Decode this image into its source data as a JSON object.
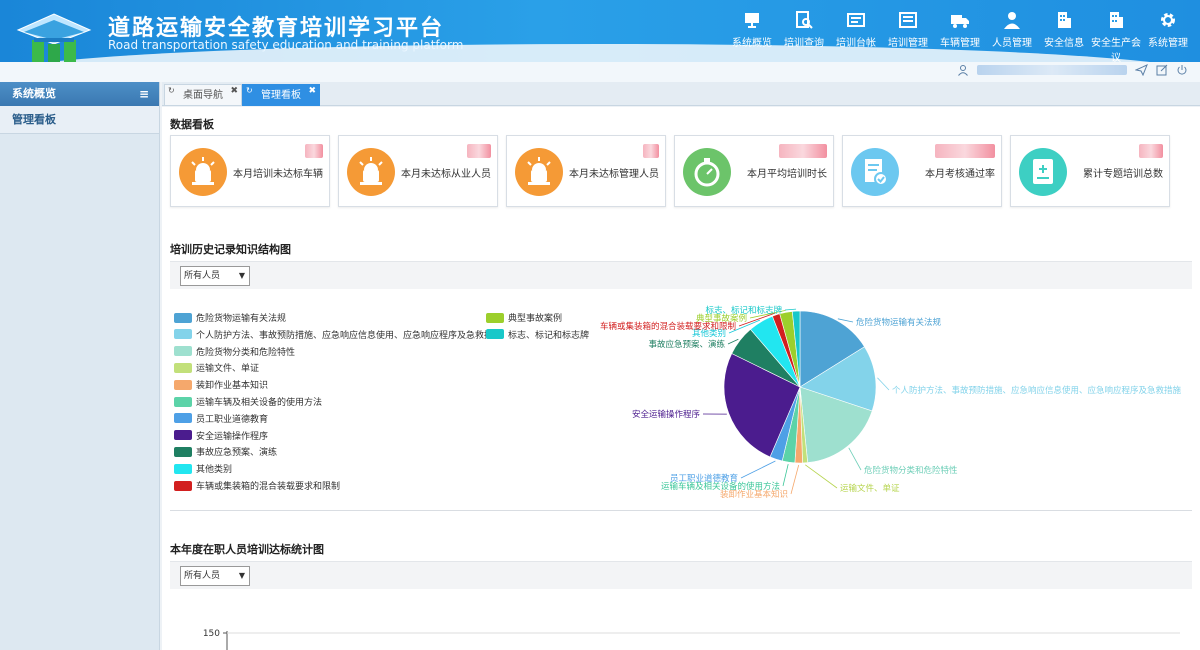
{
  "header": {
    "title_cn": "道路运输安全教育培训学习平台",
    "title_en": "Road transportation safety education and training platform",
    "nav": [
      {
        "label": "系统概览",
        "icon": "monitor-icon"
      },
      {
        "label": "培训查询",
        "icon": "search-doc-icon"
      },
      {
        "label": "培训台帐",
        "icon": "ledger-icon"
      },
      {
        "label": "培训管理",
        "icon": "training-icon"
      },
      {
        "label": "车辆管理",
        "icon": "truck-icon"
      },
      {
        "label": "人员管理",
        "icon": "user-icon"
      },
      {
        "label": "安全信息",
        "icon": "building-icon"
      },
      {
        "label": "安全生产会议",
        "icon": "meeting-icon"
      },
      {
        "label": "系统管理",
        "icon": "gear-icon"
      }
    ]
  },
  "sidebar": {
    "title": "系统概览",
    "items": [
      {
        "label": "管理看板"
      }
    ]
  },
  "tabs": [
    {
      "label": "桌面导航",
      "active": false
    },
    {
      "label": "管理看板",
      "active": true
    }
  ],
  "dashboard": {
    "title": "数据看板",
    "cards": [
      {
        "label": "本月培训未达标车辆",
        "color": "#f59a36",
        "icon": "alarm-icon"
      },
      {
        "label": "本月未达标从业人员",
        "color": "#f59a36",
        "icon": "alarm-icon"
      },
      {
        "label": "本月未达标管理人员",
        "color": "#f59a36",
        "icon": "alarm-icon"
      },
      {
        "label": "本月平均培训时长",
        "color": "#6cc46a",
        "icon": "stopwatch-icon"
      },
      {
        "label": "本月考核通过率",
        "color": "#6cc8f0",
        "icon": "document-check-icon"
      },
      {
        "label": "累计专题培训总数",
        "color": "#3dcfc3",
        "icon": "book-icon"
      }
    ]
  },
  "knowledge_chart": {
    "title": "培训历史记录知识结构图",
    "filter": "所有人员"
  },
  "chart_data": {
    "type": "pie",
    "categories": [
      "危险货物运输有关法规",
      "个人防护方法、事故预防措施、应急响应信息使用、应急响应程序及急救措施",
      "危险货物分类和危险特性",
      "运输文件、单证",
      "装卸作业基本知识",
      "运输车辆及相关设备的使用方法",
      "员工职业道德教育",
      "安全运输操作程序",
      "事故应急预案、演练",
      "其他类别",
      "车辆或集装箱的混合装载要求和限制",
      "典型事故案例",
      "标志、标记和标志牌"
    ],
    "values": [
      15,
      13,
      17,
      1,
      1.5,
      2.5,
      2.5,
      24,
      6,
      5,
      1.5,
      2.5,
      1.5
    ],
    "colors": [
      "#4ea3d4",
      "#83d3ea",
      "#9ee0cf",
      "#c2e07a",
      "#f5a86c",
      "#5cd3a8",
      "#4ea0e6",
      "#4b1c8e",
      "#1f7f62",
      "#22e6f0",
      "#d21f1f",
      "#9ccf2c",
      "#18c8c9"
    ],
    "label_colors": [
      "#4ea3d4",
      "#83d3ea",
      "#6fcfb8",
      "#b6d44e",
      "#f5a86c",
      "#3dc79a",
      "#4ea0e6",
      "#4b1c8e",
      "#1f7f62",
      "#18c8d8",
      "#d21f1f",
      "#9ccf2c",
      "#18c8c9"
    ],
    "legend_placement": "left"
  },
  "annual_chart": {
    "title": "本年度在职人员培训达标统计图",
    "filter": "所有人员",
    "y_tick": "150"
  }
}
